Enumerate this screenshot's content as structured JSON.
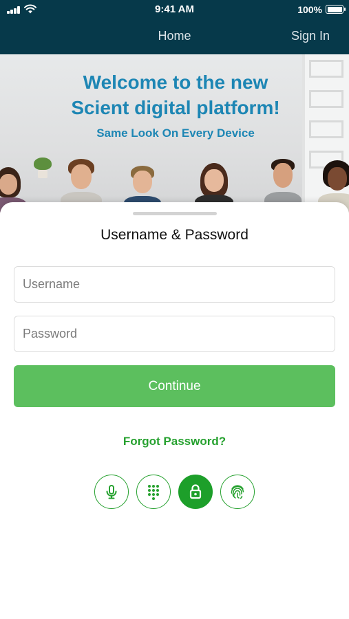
{
  "status_bar": {
    "time": "9:41 AM",
    "battery": "100%"
  },
  "nav": {
    "title": "Home",
    "sign_in": "Sign In"
  },
  "hero": {
    "title_line1": "Welcome to the new",
    "title_line2": "Scient digital platform!",
    "subtitle": "Same Look On Every Device"
  },
  "login": {
    "title": "Username & Password",
    "username_placeholder": "Username",
    "password_placeholder": "Password",
    "continue_label": "Continue",
    "forgot_label": "Forgot Password?"
  },
  "auth_methods": [
    {
      "icon": "microphone-icon",
      "active": false
    },
    {
      "icon": "keypad-icon",
      "active": false
    },
    {
      "icon": "lock-icon",
      "active": true
    },
    {
      "icon": "fingerprint-icon",
      "active": false
    }
  ],
  "colors": {
    "header_bg": "#06394a",
    "hero_text": "#1d86b4",
    "accent_green": "#26a12f",
    "button_green": "#5cbf5e"
  }
}
